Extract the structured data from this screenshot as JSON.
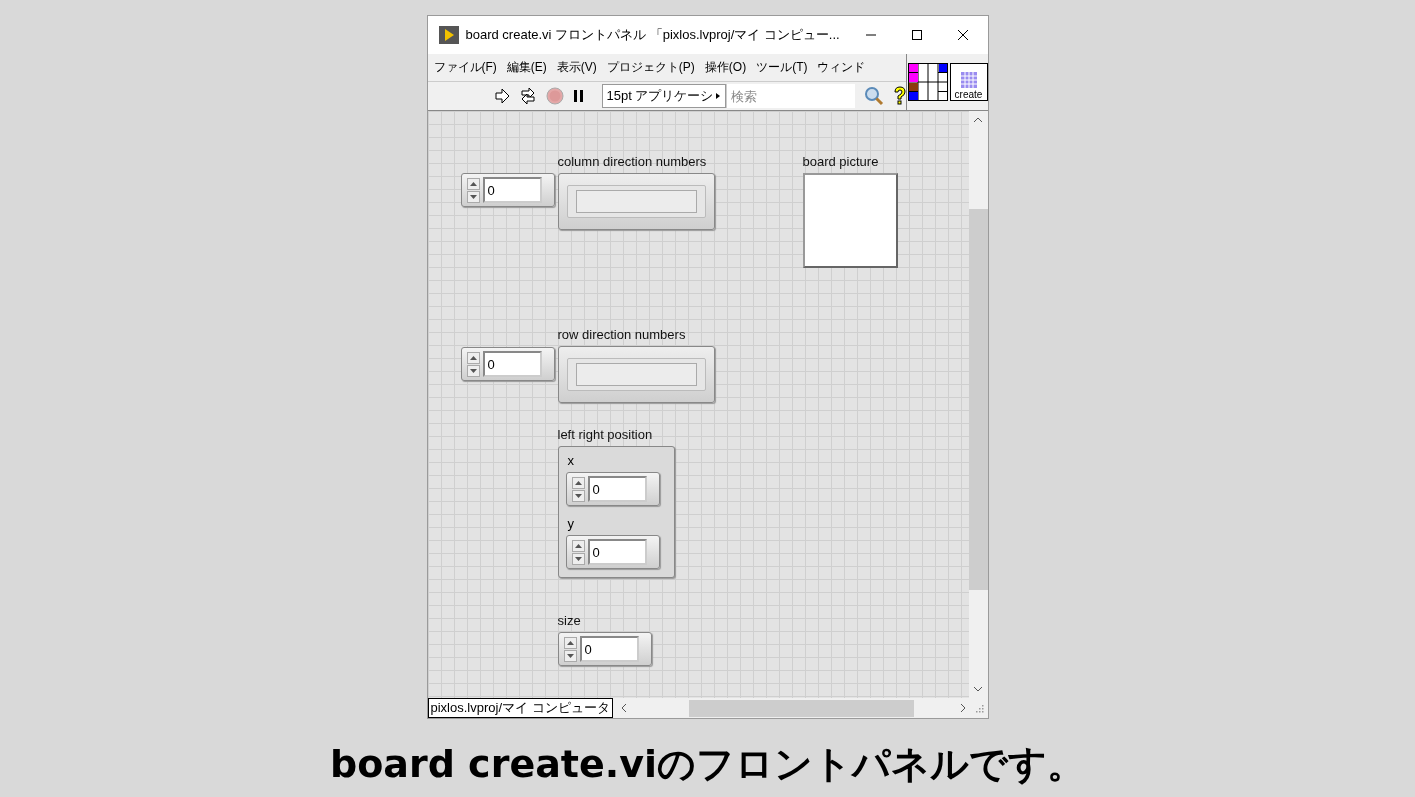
{
  "window": {
    "title": "board create.vi フロントパネル 「pixlos.lvproj/マイ コンピュー..."
  },
  "menus": [
    "ファイル(F)",
    "編集(E)",
    "表示(V)",
    "プロジェクト(P)",
    "操作(O)",
    "ツール(T)",
    "ウィンド"
  ],
  "toolbar": {
    "font_select": "15pt アプリケーシ",
    "search": {
      "placeholder": "検索"
    }
  },
  "icon_pane": {
    "label": "create"
  },
  "front_panel": {
    "controls": [
      {
        "kind": "numeric",
        "value": "0"
      },
      {
        "kind": "array",
        "label": "column direction numbers"
      },
      {
        "kind": "picture",
        "label": "board picture"
      },
      {
        "kind": "numeric",
        "value": "0"
      },
      {
        "kind": "array",
        "label": "row direction numbers"
      },
      {
        "kind": "cluster",
        "label": "left right position",
        "fields": [
          {
            "label": "x",
            "value": "0"
          },
          {
            "label": "y",
            "value": "0"
          }
        ]
      },
      {
        "kind": "numeric",
        "label": "size",
        "value": "0"
      }
    ]
  },
  "status_bar": {
    "context": "pixlos.lvproj/マイ コンピュータ"
  },
  "caption": "board create.viのフロントパネルです。"
}
